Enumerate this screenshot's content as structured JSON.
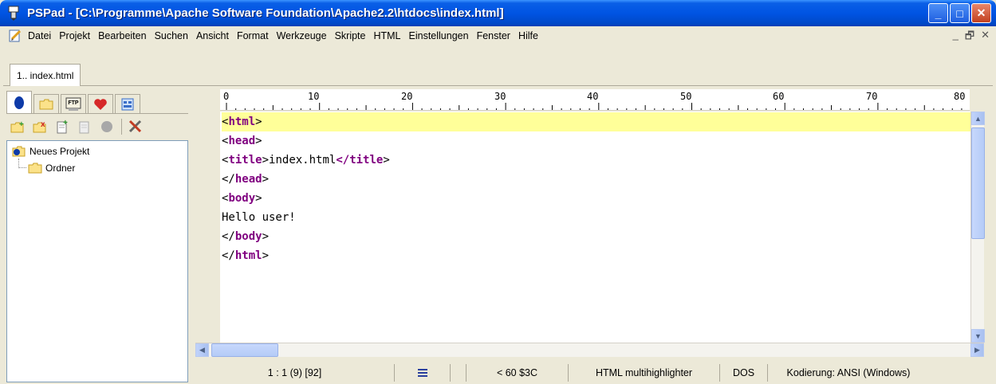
{
  "window": {
    "title": "PSPad - [C:\\Programme\\Apache Software Foundation\\Apache2.2\\htdocs\\index.html]",
    "minimize_glyph": "_",
    "maximize_glyph": "□",
    "close_glyph": "✕"
  },
  "menubar": {
    "items": [
      "Datei",
      "Projekt",
      "Bearbeiten",
      "Suchen",
      "Ansicht",
      "Format",
      "Werkzeuge",
      "Skripte",
      "HTML",
      "Einstellungen",
      "Fenster",
      "Hilfe"
    ],
    "mdi_minimize": "_",
    "mdi_restore": "🗗",
    "mdi_close": "✕"
  },
  "doc_tabs": [
    {
      "label": "1.. index.html"
    }
  ],
  "left_panel": {
    "tabs": [
      "project-icon",
      "folder-icon",
      "ftp-icon",
      "heart-icon",
      "clipboard-icon"
    ],
    "ftp_label": "FTP",
    "toolbar": [
      "new-project-icon",
      "close-project-icon",
      "add-file-icon",
      "remove-file-icon",
      "gray-circle-icon",
      "tools-icon"
    ],
    "tree": {
      "root": "Neues Projekt",
      "children": [
        "Ordner"
      ]
    }
  },
  "ruler": {
    "labels": [
      "0",
      "10",
      "20",
      "30",
      "40",
      "50",
      "60",
      "70",
      "80"
    ]
  },
  "editor": {
    "lines": [
      {
        "open": "<",
        "tag": "html",
        "close": ">",
        "text": ""
      },
      {
        "open": "<",
        "tag": "head",
        "close": ">",
        "text": ""
      },
      {
        "open": "<",
        "tag": "title",
        "close": ">",
        "text": "index.html",
        "end_open": "</",
        "end_tag": "title",
        "end_close": ">"
      },
      {
        "open": "</",
        "tag": "head",
        "close": ">",
        "text": ""
      },
      {
        "open": "<",
        "tag": "body",
        "close": ">",
        "text": ""
      },
      {
        "plain": "Hello user!"
      },
      {
        "open": "</",
        "tag": "body",
        "close": ">",
        "text": ""
      },
      {
        "open": "</",
        "tag": "html",
        "close": ">",
        "text": ""
      }
    ],
    "current_line": 0
  },
  "statusbar": {
    "position": "1 : 1  (9)  [92]",
    "char_info": "<  60  $3C",
    "highlighter": "HTML multihighlighter",
    "line_endings": "DOS",
    "encoding": "Kodierung: ANSI (Windows)"
  },
  "colors": {
    "title_bar": "#0054e3",
    "tag": "#800080",
    "current_line": "#ffff99"
  }
}
